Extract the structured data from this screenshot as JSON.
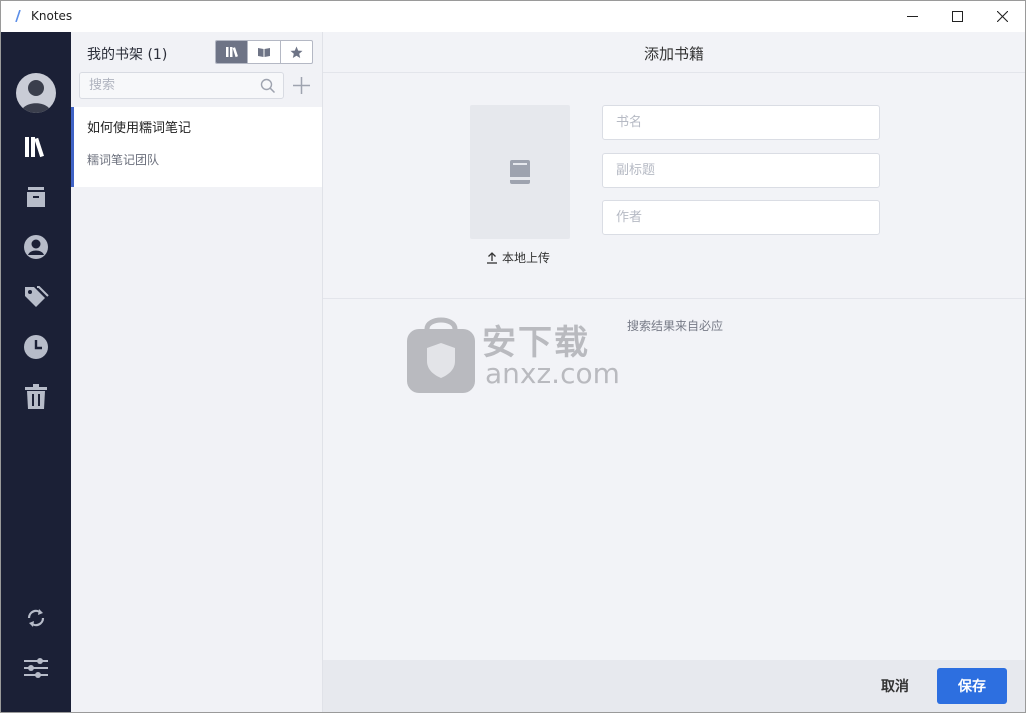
{
  "window": {
    "title": "Knotes"
  },
  "titlebar": {
    "minimize_icon": "minimize-icon",
    "maximize_icon": "maximize-icon",
    "close_icon": "close-icon"
  },
  "rail": {
    "items": [
      {
        "name": "library",
        "icon": "bookshelf-icon"
      },
      {
        "name": "inbox",
        "icon": "archive-box-icon"
      },
      {
        "name": "profile",
        "icon": "user-circle-icon"
      },
      {
        "name": "tags",
        "icon": "tags-icon"
      },
      {
        "name": "history",
        "icon": "clock-icon"
      },
      {
        "name": "trash",
        "icon": "trash-icon"
      }
    ],
    "bottom": [
      {
        "name": "sync",
        "icon": "sync-icon"
      },
      {
        "name": "settings",
        "icon": "sliders-icon"
      }
    ]
  },
  "shelf": {
    "title": "我的书架 (1)",
    "views": [
      "bookshelf-view-icon",
      "open-book-view-icon",
      "star-view-icon"
    ],
    "search_placeholder": "搜索",
    "books": [
      {
        "title": "如何使用糯词笔记",
        "author": "糯词笔记团队"
      }
    ]
  },
  "add_book": {
    "title": "添加书籍",
    "upload_label": "本地上传",
    "fields": {
      "name_placeholder": "书名",
      "subtitle_placeholder": "副标题",
      "author_placeholder": "作者"
    },
    "search_note": "搜索结果来自必应",
    "cancel_label": "取消",
    "save_label": "保存"
  },
  "watermark": {
    "text": "安下载",
    "sub": "anxz.com"
  },
  "colors": {
    "rail_bg": "#1b2036",
    "accent": "#2d6fe0",
    "selected_border": "#3f63c6"
  }
}
